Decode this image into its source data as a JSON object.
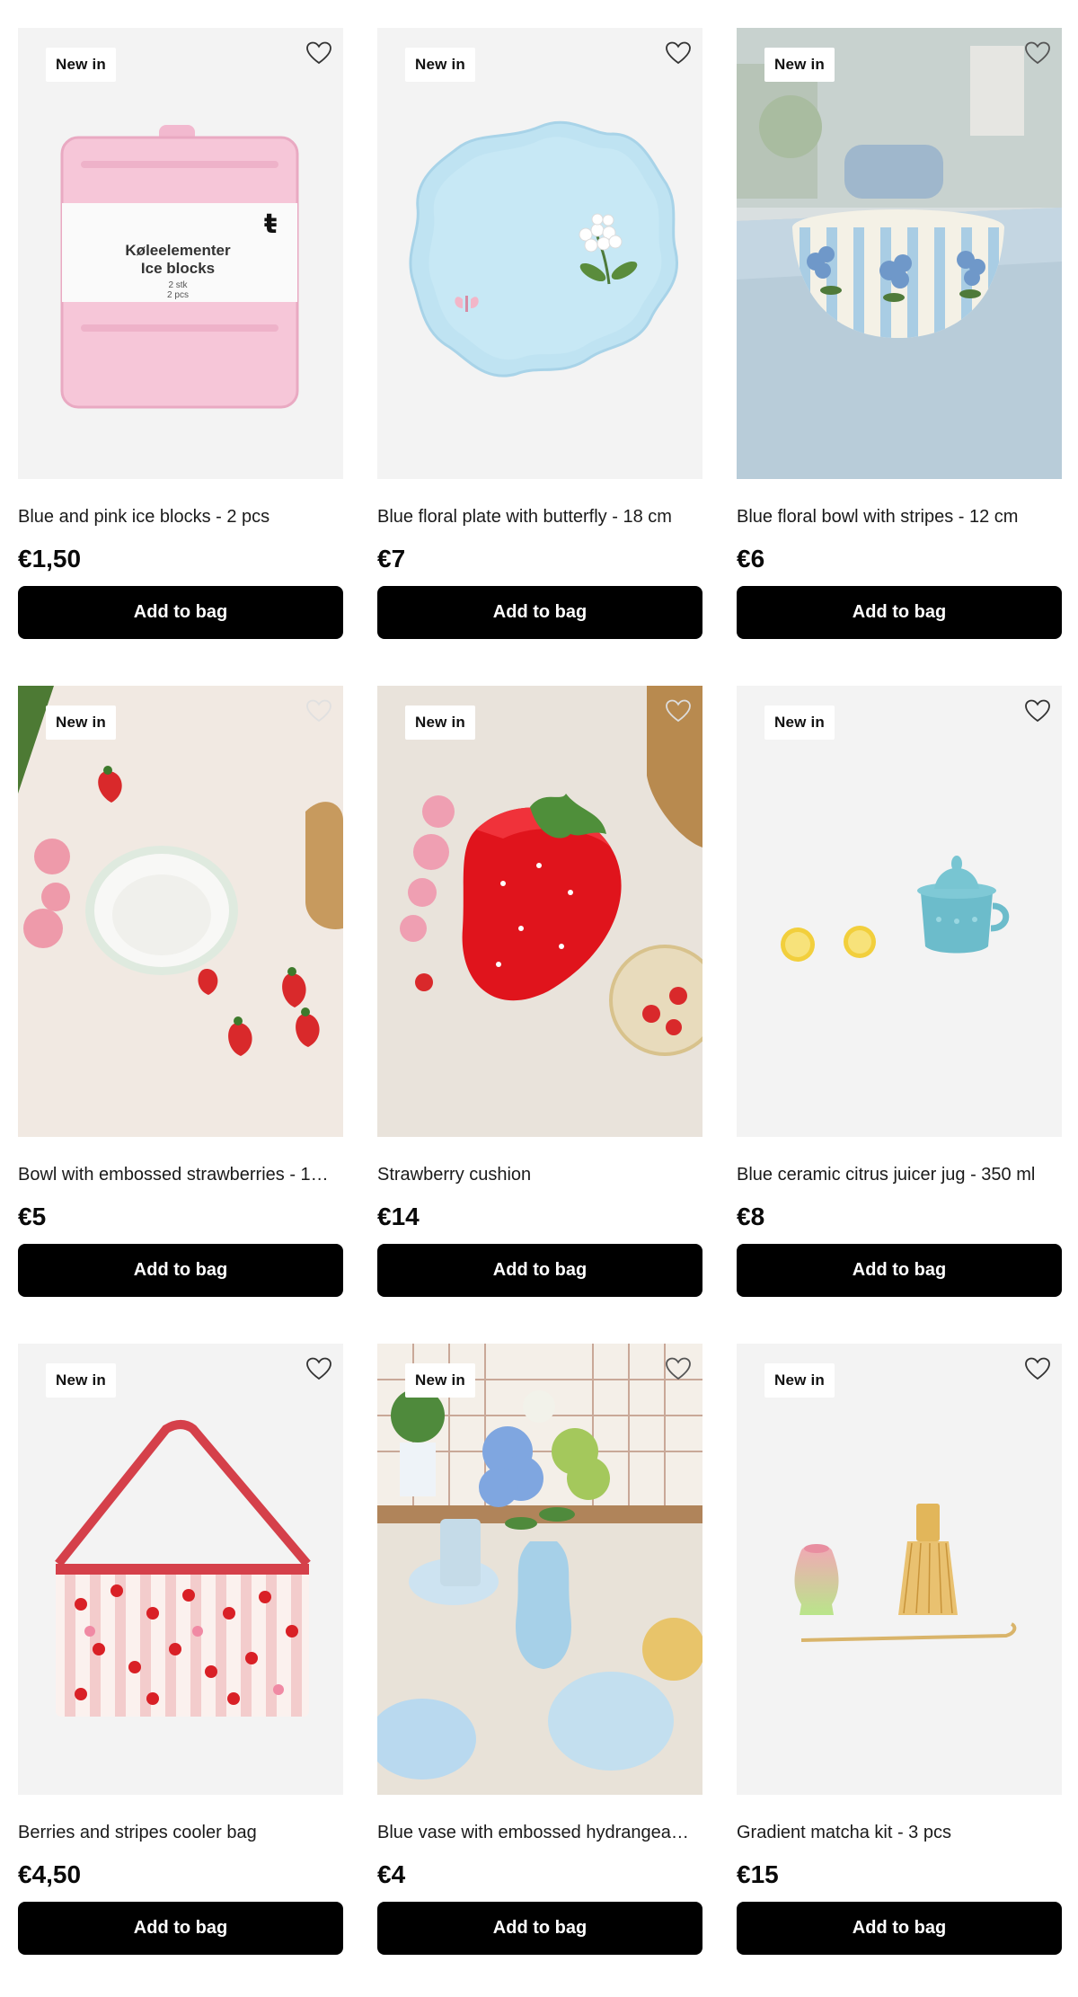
{
  "badge_label": "New in",
  "add_label": "Add to bag",
  "products": [
    {
      "title": "Blue and pink ice blocks - 2 pcs",
      "price": "€1,50",
      "pack_text": [
        "Køleelementer",
        "Ice blocks",
        "2 stk",
        "2 pcs"
      ]
    },
    {
      "title": "Blue floral plate with butterfly - 18 cm",
      "price": "€7"
    },
    {
      "title": "Blue floral bowl with stripes - 12 cm",
      "price": "€6"
    },
    {
      "title": "Bowl with embossed strawberries - 1…",
      "price": "€5"
    },
    {
      "title": "Strawberry cushion",
      "price": "€14"
    },
    {
      "title": "Blue ceramic citrus juicer jug - 350 ml",
      "price": "€8"
    },
    {
      "title": "Berries and stripes cooler bag",
      "price": "€4,50"
    },
    {
      "title": "Blue vase with embossed hydrangea…",
      "price": "€4"
    },
    {
      "title": "Gradient matcha kit - 3 pcs",
      "price": "€15"
    }
  ],
  "colors": {
    "button_bg": "#000000",
    "button_text": "#ffffff",
    "image_bg": "#f3f3f3"
  }
}
